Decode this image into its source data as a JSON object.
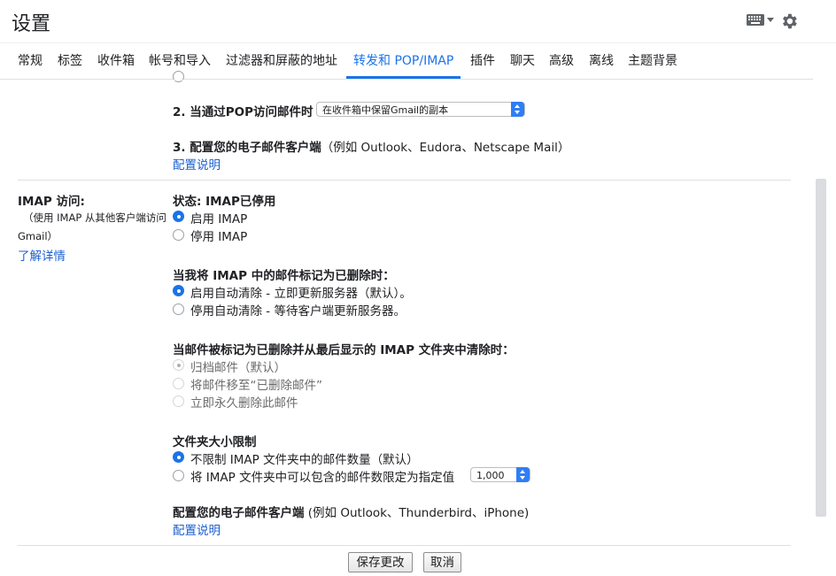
{
  "header": {
    "title": "设置"
  },
  "tabs": [
    "常规",
    "标签",
    "收件箱",
    "帐号和导入",
    "过滤器和屏蔽的地址",
    "转发和 POP/IMAP",
    "插件",
    "聊天",
    "高级",
    "离线",
    "主题背景"
  ],
  "active_tab_index": 5,
  "pop": {
    "step2_label": "2. 当通过POP访问邮件时",
    "step2_select": "在收件箱中保留Gmail的副本",
    "step3_label": "3. 配置您的电子邮件客户端",
    "step3_suffix": "（例如 Outlook、Eudora、Netscape Mail）",
    "config_link": "配置说明"
  },
  "imap_side": {
    "title": "IMAP 访问:",
    "desc_line1": "（使用 IMAP 从其他客户端访问",
    "desc_line2": "Gmail）",
    "learn_more": "了解详情"
  },
  "imap": {
    "status": "状态: IMAP已停用",
    "enable": "启用 IMAP",
    "disable": "停用 IMAP",
    "deleted_heading": "当我将 IMAP 中的邮件标记为已删除时：",
    "auto_expunge_on": "启用自动清除 - 立即更新服务器（默认）。",
    "auto_expunge_off": "停用自动清除 - 等待客户端更新服务器。",
    "expunge_heading": "当邮件被标记为已删除并从最后显示的 IMAP 文件夹中清除时：",
    "archive": "归档邮件（默认）",
    "move_trash": "将邮件移至“已删除邮件”",
    "delete_forever": "立即永久删除此邮件",
    "folder_heading": "文件夹大小限制",
    "no_limit": "不限制 IMAP 文件夹中的邮件数量（默认）",
    "limit": "将 IMAP 文件夹中可以包含的邮件数限定为指定值",
    "limit_value": "1,000",
    "client_label": "配置您的电子邮件客户端",
    "client_suffix": " (例如 Outlook、Thunderbird、iPhone)",
    "config_link": "配置说明"
  },
  "buttons": {
    "save": "保存更改",
    "cancel": "取消"
  },
  "colors": {
    "accent": "#1a73e8",
    "link": "#1a5fd0"
  }
}
